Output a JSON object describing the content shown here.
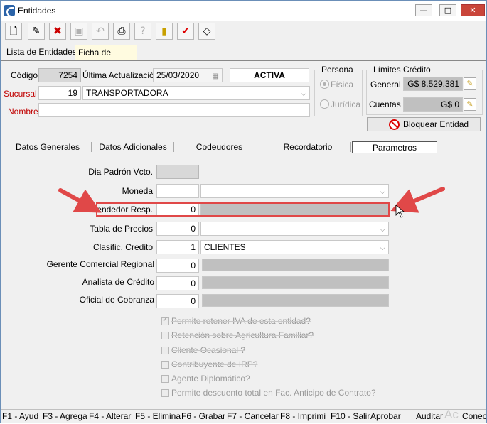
{
  "window": {
    "title": "Entidades",
    "minimize": "—",
    "maximize": "□",
    "close": "✕"
  },
  "toolbar": [
    "new-doc-icon",
    "edit-doc-icon",
    "delete-doc-icon",
    "save-icon",
    "undo-icon",
    "print-icon",
    "help-icon",
    "exit-icon",
    "confirm-icon",
    "clear-icon"
  ],
  "tabs": {
    "lista": "Lista de Entidades",
    "ficha": "Ficha de Entidad"
  },
  "header": {
    "codigo_label": "Código",
    "codigo": "7254",
    "ult_act_label": "Última Actualización",
    "ult_act": "25/03/2020",
    "estado": "ACTIVA",
    "sucursal_label": "Sucursal",
    "sucursal_num": "19",
    "sucursal_nombre": "TRANSPORTADORA",
    "nombre_label": "Nombre",
    "nombre": "",
    "persona_title": "Persona",
    "fisica": "Física",
    "juridica": "Jurídica",
    "limites_title": "Límites Crédito",
    "general_label": "General",
    "general": "G$ 8.529.381",
    "cuentas_label": "Cuentas",
    "cuentas": "G$ 0",
    "bloquear": "Bloquear Entidad"
  },
  "subtabs": [
    "Datos Generales",
    "Datos Adicionales",
    "Codeudores",
    "Recordatorio",
    "Parametros Comerciales"
  ],
  "form": {
    "dia_padron_label": "Dia Padrón Vcto.",
    "dia_padron": "",
    "moneda_label": "Moneda",
    "moneda_code": "",
    "moneda": "",
    "vendedor_label": "Vendedor Resp.",
    "vendedor": "0",
    "vendedor_nombre": "",
    "tabla_precios_label": "Tabla de Precios",
    "tabla_precios": "0",
    "tabla_precios_nombre": "",
    "clasif_label": "Clasific. Credito",
    "clasif": "1",
    "clasif_nombre": "CLIENTES",
    "gerente_label": "Gerente Comercial Regional",
    "gerente": "0",
    "analista_label": "Analista de Crédito",
    "analista": "0",
    "oficial_label": "Oficial de Cobranza",
    "oficial": "0"
  },
  "checks": [
    {
      "label": "Permite retener IVA de esta entidad?",
      "checked": true
    },
    {
      "label": "Retención sobre Agricultura Familiar?",
      "checked": false
    },
    {
      "label": "Cliente Ocasional ?",
      "checked": false
    },
    {
      "label": "Contribuyente de IRP?",
      "checked": false
    },
    {
      "label": "Agente Diplomático?",
      "checked": false
    },
    {
      "label": "Permite descuento total en Fac. Anticipo de Contrato?",
      "checked": false
    }
  ],
  "statusbar": [
    "F1 - Ayud",
    "F3 - Agrega",
    "F4 - Alterar",
    "F5 - Elimina",
    "F6 - Grabar",
    "F7 - Cancelar",
    "F8 - Imprimi",
    "F10 - Salir",
    "Aprobar",
    "Auditar",
    "Conec"
  ],
  "watermark": "Ac",
  "colors": {
    "highlight": "#e04848",
    "title_bar": "#ffffff",
    "status_red": "#c00000"
  }
}
